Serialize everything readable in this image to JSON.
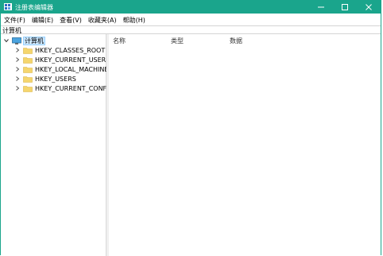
{
  "window": {
    "title": "注册表编辑器"
  },
  "menu": [
    "文件(F)",
    "编辑(E)",
    "查看(V)",
    "收藏夹(A)",
    "帮助(H)"
  ],
  "address": {
    "path": "计算机"
  },
  "tree": {
    "root": "计算机",
    "keys": [
      "HKEY_CLASSES_ROOT",
      "HKEY_CURRENT_USER",
      "HKEY_LOCAL_MACHINE",
      "HKEY_USERS",
      "HKEY_CURRENT_CONFIG"
    ]
  },
  "columns": [
    "名称",
    "类型",
    "数据"
  ],
  "colors": {
    "titlebar": "#1aa58c",
    "selection": "#cce8ff",
    "folder": "#f5d66e"
  },
  "icons": {
    "app": "regedit-icon",
    "minimize": "minimize-icon",
    "maximize": "maximize-icon",
    "close": "close-icon",
    "computer": "computer-icon",
    "folder": "folder-icon",
    "expand": "chevron-right-icon",
    "collapse": "chevron-down-icon"
  }
}
